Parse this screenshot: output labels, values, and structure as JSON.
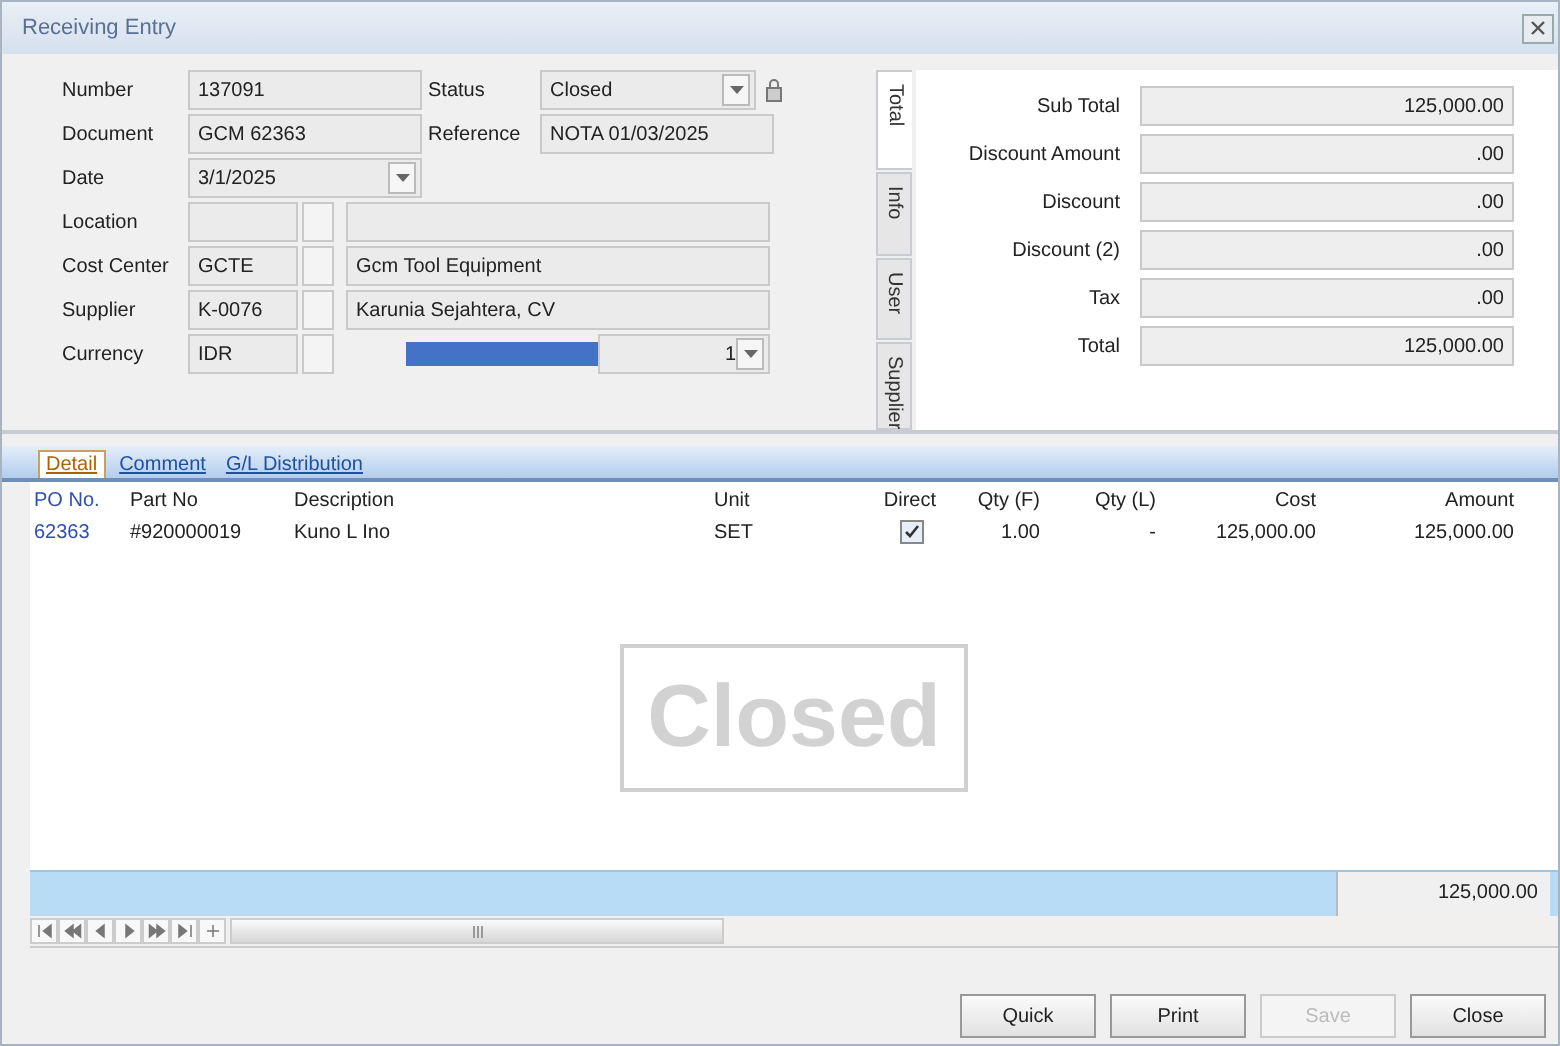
{
  "window": {
    "title": "Receiving Entry"
  },
  "header_fields": [
    {
      "kind": "text",
      "label": "Number",
      "value": "137091"
    },
    {
      "kind": "combo",
      "label": "Status",
      "value": "Closed",
      "locked": true
    },
    {
      "kind": "text",
      "label": "Document",
      "value": "GCM 62363"
    },
    {
      "kind": "text",
      "label": "Reference",
      "value": "NOTA 01/03/2025"
    },
    {
      "kind": "date",
      "label": "Date",
      "value": "3/1/2025"
    }
  ],
  "lookup_fields": [
    {
      "label": "Location"
    },
    {
      "label": "Cost Center",
      "code": "GCTE",
      "name": "Gcm Tool Equipment"
    },
    {
      "label": "Supplier",
      "code": "K-0076",
      "name": "Karunia Sejahtera, CV"
    },
    {
      "label": "Currency",
      "code": "IDR",
      "rate": "1"
    }
  ],
  "side_tabs": [
    {
      "label": "Total",
      "selected": true
    },
    {
      "label": "Info",
      "selected": false
    },
    {
      "label": "User",
      "selected": false
    },
    {
      "label": "Supplier",
      "selected": false
    }
  ],
  "totals": [
    {
      "label": "Sub Total",
      "value": "125,000.00"
    },
    {
      "label": "Discount Amount",
      "value": ".00"
    },
    {
      "label": "Discount",
      "value": ".00"
    },
    {
      "label": "Discount (2)",
      "value": ".00"
    },
    {
      "label": "Tax",
      "value": ".00"
    },
    {
      "label": "Total",
      "value": "125,000.00"
    }
  ],
  "tabs": [
    {
      "label": "Detail",
      "selected": true
    },
    {
      "label": "Comment",
      "selected": false
    },
    {
      "label": "G/L Distribution",
      "selected": false
    }
  ],
  "table": {
    "columns": [
      {
        "label": "PO No.",
        "kind": "link"
      },
      {
        "label": "Part No",
        "kind": "text"
      },
      {
        "label": "Description",
        "kind": "text"
      },
      {
        "label": "Unit",
        "kind": "text"
      },
      {
        "label": "Direct",
        "kind": "check"
      },
      {
        "label": "Qty (F)",
        "kind": "number"
      },
      {
        "label": "Qty (L)",
        "kind": "number"
      },
      {
        "label": "Cost",
        "kind": "number"
      },
      {
        "label": "Amount",
        "kind": "number"
      }
    ],
    "rows": [
      {
        "cells": [
          "62363",
          "#920000019",
          "Kuno L Ino",
          "SET",
          {
            "checked": true
          },
          "1.00",
          "-",
          "125,000.00",
          "125,000.00"
        ]
      }
    ],
    "footer_total": "125,000.00"
  },
  "stamp": "Closed",
  "navigator": [
    {
      "kind": "first"
    },
    {
      "kind": "prev-page"
    },
    {
      "kind": "prev"
    },
    {
      "kind": "next"
    },
    {
      "kind": "next-page"
    },
    {
      "kind": "last"
    },
    {
      "kind": "add"
    }
  ],
  "buttons": [
    {
      "label": "Quick",
      "disabled": false
    },
    {
      "label": "Print",
      "disabled": false
    },
    {
      "label": "Save",
      "disabled": true
    },
    {
      "label": "Close",
      "disabled": false
    }
  ]
}
